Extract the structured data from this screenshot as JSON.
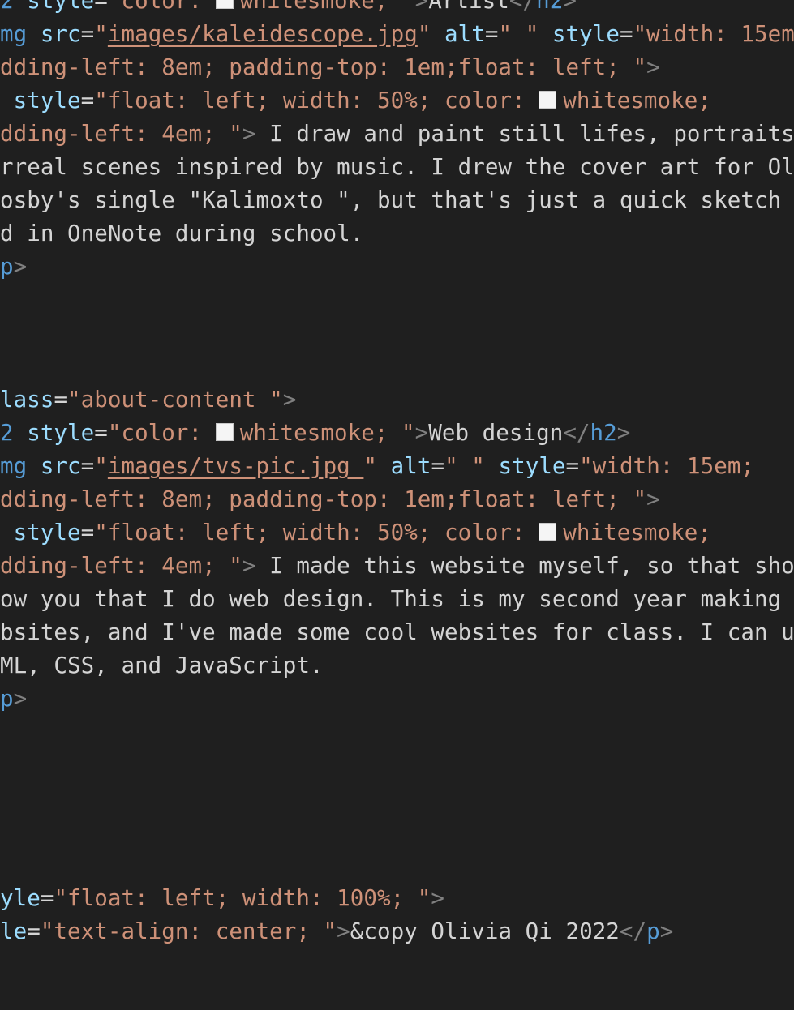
{
  "editor": {
    "colors": {
      "background": "#1f1f1f",
      "tag": "#569cd6",
      "bracket": "#808080",
      "attribute": "#9cdcfe",
      "string": "#ce9178",
      "text": "#d4d4d4",
      "swatch": "#f5f5f5"
    },
    "lines": [
      {
        "tokens": [
          {
            "t": "tag",
            "v": "2"
          },
          {
            "t": "text",
            "v": " "
          },
          {
            "t": "attr",
            "v": "style"
          },
          {
            "t": "text",
            "v": "="
          },
          {
            "t": "str",
            "v": "\"color: "
          },
          {
            "t": "swatch",
            "v": "whitesmoke-color-swatch"
          },
          {
            "t": "str",
            "v": "whitesmoke; \""
          },
          {
            "t": "br",
            "v": ">"
          },
          {
            "t": "text",
            "v": "Artist"
          },
          {
            "t": "br",
            "v": "</"
          },
          {
            "t": "tag",
            "v": "h2"
          },
          {
            "t": "br",
            "v": ">"
          }
        ]
      },
      {
        "tokens": [
          {
            "t": "tag",
            "v": "mg"
          },
          {
            "t": "text",
            "v": " "
          },
          {
            "t": "attr",
            "v": "src"
          },
          {
            "t": "text",
            "v": "="
          },
          {
            "t": "str",
            "v": "\""
          },
          {
            "t": "link",
            "v": "images/kaleidescope.jpg"
          },
          {
            "t": "str",
            "v": "\""
          },
          {
            "t": "text",
            "v": " "
          },
          {
            "t": "attr",
            "v": "alt"
          },
          {
            "t": "text",
            "v": "="
          },
          {
            "t": "str",
            "v": "\" \""
          },
          {
            "t": "text",
            "v": " "
          },
          {
            "t": "attr",
            "v": "style"
          },
          {
            "t": "text",
            "v": "="
          },
          {
            "t": "str",
            "v": "\"width: 15em;"
          }
        ]
      },
      {
        "tokens": [
          {
            "t": "str",
            "v": "dding-left: 8em; padding-top: 1em;float: left; \""
          },
          {
            "t": "br",
            "v": ">"
          }
        ]
      },
      {
        "tokens": [
          {
            "t": "text",
            "v": " "
          },
          {
            "t": "attr",
            "v": "style"
          },
          {
            "t": "text",
            "v": "="
          },
          {
            "t": "str",
            "v": "\"float: left; width: 50%; color: "
          },
          {
            "t": "swatch",
            "v": "whitesmoke-color-swatch"
          },
          {
            "t": "str",
            "v": "whitesmoke;"
          }
        ]
      },
      {
        "tokens": [
          {
            "t": "str",
            "v": "dding-left: 4em; \""
          },
          {
            "t": "br",
            "v": ">"
          },
          {
            "t": "text",
            "v": " I draw and paint still lifes, portraits, a"
          }
        ]
      },
      {
        "tokens": [
          {
            "t": "text",
            "v": "rreal scenes inspired by music. I drew the cover art for Oli"
          }
        ]
      },
      {
        "tokens": [
          {
            "t": "text",
            "v": "osby's single \"Kalimoxto \", but that's just a quick sketch I"
          }
        ]
      },
      {
        "tokens": [
          {
            "t": "text",
            "v": "d in OneNote during school."
          }
        ]
      },
      {
        "tokens": [
          {
            "t": "tag",
            "v": "p"
          },
          {
            "t": "br",
            "v": ">"
          }
        ]
      },
      {
        "tokens": []
      },
      {
        "tokens": []
      },
      {
        "tokens": []
      },
      {
        "tokens": [
          {
            "t": "attr",
            "v": "lass"
          },
          {
            "t": "text",
            "v": "="
          },
          {
            "t": "str",
            "v": "\"about-content \""
          },
          {
            "t": "br",
            "v": ">"
          }
        ]
      },
      {
        "tokens": [
          {
            "t": "tag",
            "v": "2"
          },
          {
            "t": "text",
            "v": " "
          },
          {
            "t": "attr",
            "v": "style"
          },
          {
            "t": "text",
            "v": "="
          },
          {
            "t": "str",
            "v": "\"color: "
          },
          {
            "t": "swatch",
            "v": "whitesmoke-color-swatch"
          },
          {
            "t": "str",
            "v": "whitesmoke; \""
          },
          {
            "t": "br",
            "v": ">"
          },
          {
            "t": "text",
            "v": "Web design"
          },
          {
            "t": "br",
            "v": "</"
          },
          {
            "t": "tag",
            "v": "h2"
          },
          {
            "t": "br",
            "v": ">"
          }
        ]
      },
      {
        "tokens": [
          {
            "t": "tag",
            "v": "mg"
          },
          {
            "t": "text",
            "v": " "
          },
          {
            "t": "attr",
            "v": "src"
          },
          {
            "t": "text",
            "v": "="
          },
          {
            "t": "str",
            "v": "\""
          },
          {
            "t": "link",
            "v": "images/tvs-pic.jpg "
          },
          {
            "t": "str",
            "v": "\""
          },
          {
            "t": "text",
            "v": " "
          },
          {
            "t": "attr",
            "v": "alt"
          },
          {
            "t": "text",
            "v": "="
          },
          {
            "t": "str",
            "v": "\" \""
          },
          {
            "t": "text",
            "v": " "
          },
          {
            "t": "attr",
            "v": "style"
          },
          {
            "t": "text",
            "v": "="
          },
          {
            "t": "str",
            "v": "\"width: 15em;"
          }
        ]
      },
      {
        "tokens": [
          {
            "t": "str",
            "v": "dding-left: 8em; padding-top: 1em;float: left; \""
          },
          {
            "t": "br",
            "v": ">"
          }
        ]
      },
      {
        "tokens": [
          {
            "t": "text",
            "v": " "
          },
          {
            "t": "attr",
            "v": "style"
          },
          {
            "t": "text",
            "v": "="
          },
          {
            "t": "str",
            "v": "\"float: left; width: 50%; color: "
          },
          {
            "t": "swatch",
            "v": "whitesmoke-color-swatch"
          },
          {
            "t": "str",
            "v": "whitesmoke;"
          }
        ]
      },
      {
        "tokens": [
          {
            "t": "str",
            "v": "dding-left: 4em; \""
          },
          {
            "t": "br",
            "v": ">"
          },
          {
            "t": "text",
            "v": " I made this website myself, so that shou"
          }
        ]
      },
      {
        "tokens": [
          {
            "t": "text",
            "v": "ow you that I do web design. This is my second year making"
          }
        ]
      },
      {
        "tokens": [
          {
            "t": "text",
            "v": "bsites, and I've made some cool websites for class. I can us"
          }
        ]
      },
      {
        "tokens": [
          {
            "t": "text",
            "v": "ML, CSS, and JavaScript."
          }
        ]
      },
      {
        "tokens": [
          {
            "t": "tag",
            "v": "p"
          },
          {
            "t": "br",
            "v": ">"
          }
        ]
      },
      {
        "tokens": []
      },
      {
        "tokens": []
      },
      {
        "tokens": []
      },
      {
        "tokens": []
      },
      {
        "tokens": []
      },
      {
        "tokens": [
          {
            "t": "attr",
            "v": "yle"
          },
          {
            "t": "text",
            "v": "="
          },
          {
            "t": "str",
            "v": "\"float: left; width: 100%; \""
          },
          {
            "t": "br",
            "v": ">"
          }
        ]
      },
      {
        "tokens": [
          {
            "t": "attr",
            "v": "le"
          },
          {
            "t": "text",
            "v": "="
          },
          {
            "t": "str",
            "v": "\"text-align: center; \""
          },
          {
            "t": "br",
            "v": ">"
          },
          {
            "t": "text",
            "v": "&copy Olivia Qi 2022"
          },
          {
            "t": "br",
            "v": "</"
          },
          {
            "t": "tag",
            "v": "p"
          },
          {
            "t": "br",
            "v": ">"
          }
        ]
      },
      {
        "tokens": []
      }
    ]
  }
}
